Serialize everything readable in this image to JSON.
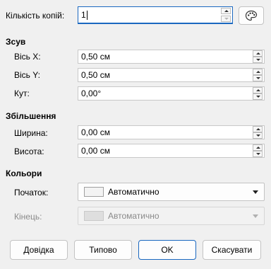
{
  "copies": {
    "label": "Кількість копій:",
    "value": "1"
  },
  "offset": {
    "title": "Зсув",
    "axis_x": {
      "label": "Вісь X:",
      "value": "0,50 см"
    },
    "axis_y": {
      "label": "Вісь Y:",
      "value": "0,50 см"
    },
    "angle": {
      "label": "Кут:",
      "value": "0,00°"
    }
  },
  "enlargement": {
    "title": "Збільшення",
    "width": {
      "label": "Ширина:",
      "value": "0,00 см"
    },
    "height": {
      "label": "Висота:",
      "value": "0,00 см"
    }
  },
  "colors": {
    "title": "Кольори",
    "start": {
      "label": "Початок:",
      "value": "Автоматично",
      "swatch": "#f3f3f3"
    },
    "end": {
      "label": "Кінець:",
      "value": "Автоматично",
      "swatch": "#dedede"
    }
  },
  "buttons": {
    "help": "Довідка",
    "reset": "Типово",
    "ok": "OK",
    "cancel": "Скасувати"
  },
  "icons": {
    "palette": "palette-icon"
  },
  "accent_color": "#1a68c0"
}
